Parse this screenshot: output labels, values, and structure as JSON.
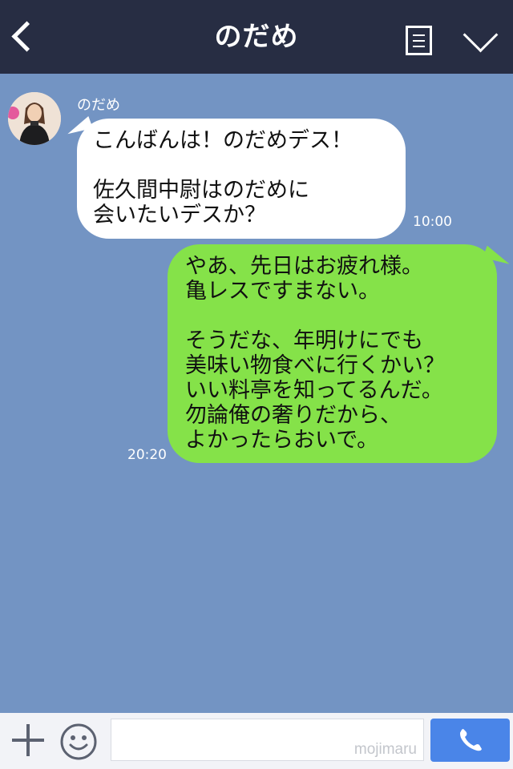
{
  "header": {
    "title": "のだめ"
  },
  "chat": {
    "incoming": {
      "sender": "のだめ",
      "text": "こんばんは！のだめデス！\n\n佐久間中尉はのだめに\n会いたいデスか？",
      "time": "10:00"
    },
    "outgoing": {
      "text": "やあ、先日はお疲れ様。\n亀レスですまない。\n\nそうだな、年明けにでも\n美味い物食べに行くかい？\nいい料亭を知ってるんだ。\n勿論俺の奢りだから、\nよかったらおいで。",
      "time": "20:20"
    }
  },
  "input": {
    "watermark": "mojimaru"
  },
  "colors": {
    "header_bg": "#272d43",
    "chat_bg": "#7394c3",
    "incoming_bubble": "#ffffff",
    "outgoing_bubble": "#85e249",
    "call_button": "#4a85e8"
  },
  "icons": {
    "back": "chevron-left-icon",
    "menu": "list-icon",
    "collapse": "chevron-down-icon",
    "add": "plus-icon",
    "emoji": "smile-icon",
    "call": "phone-icon"
  }
}
